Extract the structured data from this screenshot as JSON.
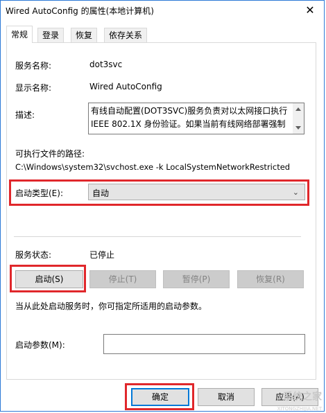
{
  "window": {
    "title": "Wired AutoConfig 的属性(本地计算机)",
    "close_glyph": "✕"
  },
  "tabs": [
    {
      "label": "常规",
      "active": true
    },
    {
      "label": "登录",
      "active": false
    },
    {
      "label": "恢复",
      "active": false
    },
    {
      "label": "依存关系",
      "active": false
    }
  ],
  "general": {
    "service_name_label": "服务名称:",
    "service_name_value": "dot3svc",
    "display_name_label": "显示名称:",
    "display_name_value": "Wired AutoConfig",
    "description_label": "描述:",
    "description_value": "有线自动配置(DOT3SVC)服务负责对以太网接口执行\nIEEE 802.1X 身份验证。如果当前有线网络部署强制执",
    "path_label": "可执行文件的路径:",
    "path_value": "C:\\Windows\\system32\\svchost.exe -k LocalSystemNetworkRestricted",
    "startup_type_label": "启动类型(E):",
    "startup_type_value": "自动",
    "status_label": "服务状态:",
    "status_value": "已停止",
    "hint": "当从此处启动服务时，你可指定所适用的启动参数。",
    "params_label": "启动参数(M):",
    "params_value": ""
  },
  "service_buttons": {
    "start": "启动(S)",
    "stop": "停止(T)",
    "pause": "暂停(P)",
    "resume": "恢复(R)"
  },
  "dialog_buttons": {
    "ok": "确定",
    "cancel": "取消",
    "apply": "应用(A)"
  },
  "watermark": {
    "text": "系统之家",
    "sub": "XITONGZHIJIA.NET"
  },
  "colors": {
    "highlight_red": "#e0272b",
    "accent_blue": "#0078d7"
  }
}
